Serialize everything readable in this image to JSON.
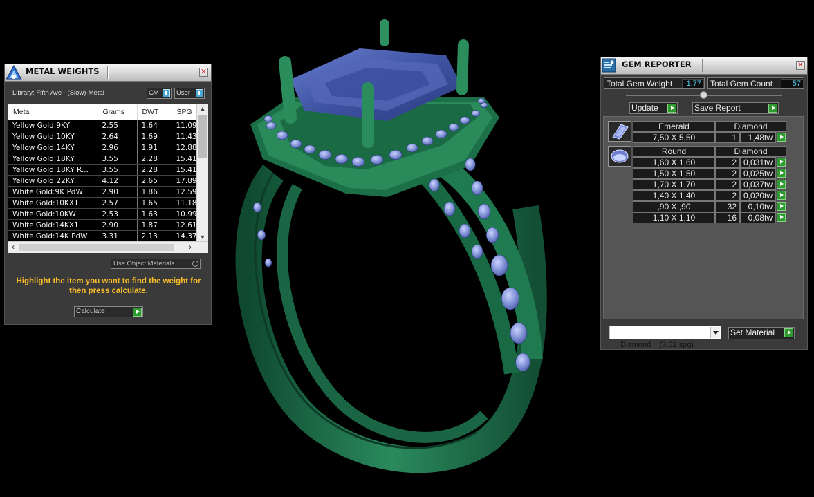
{
  "metal_weights": {
    "title": "METAL WEIGHTS",
    "library": "Library: Fifth Ave - (Slow)-Metal",
    "toggles": [
      "GV",
      "User"
    ],
    "columns": [
      "Metal",
      "Grams",
      "DWT",
      "SPG"
    ],
    "rows": [
      [
        "Yellow Gold:9KY",
        "2.55",
        "1.64",
        "11.09"
      ],
      [
        "Yellow Gold:10KY",
        "2.64",
        "1.69",
        "11.43"
      ],
      [
        "Yellow Gold:14KY",
        "2.96",
        "1.91",
        "12.88"
      ],
      [
        "Yellow Gold:18KY",
        "3.55",
        "2.28",
        "15.41"
      ],
      [
        "Yellow Gold:18KY R...",
        "3.55",
        "2.28",
        "15.41"
      ],
      [
        "Yellow Gold:22KY",
        "4.12",
        "2.65",
        "17.89"
      ],
      [
        "White Gold:9K PdW",
        "2.90",
        "1.86",
        "12.59"
      ],
      [
        "White Gold:10KX1",
        "2.57",
        "1.65",
        "11.18"
      ],
      [
        "White Gold:10KW",
        "2.53",
        "1.63",
        "10.99"
      ],
      [
        "White Gold:14KX1",
        "2.90",
        "1.87",
        "12.61"
      ],
      [
        "White Gold:14K PdW",
        "3.31",
        "2.13",
        "14.37"
      ]
    ],
    "use_object_materials": "Use Object Materials",
    "hint": "Highlight the item you want to find the weight for then press calculate.",
    "calculate_label": "Calculate"
  },
  "gem_reporter": {
    "title": "GEM REPORTER",
    "total_weight_label": "Total Gem Weight",
    "total_weight": "1,77",
    "total_count_label": "Total Gem Count",
    "total_count": "57",
    "update_label": "Update",
    "save_report_label": "Save Report",
    "groups": [
      {
        "shape": "Emerald",
        "material": "Diamond",
        "icon": "emerald-cut-gem-icon",
        "rows": [
          {
            "size": "7,50 X 5,50",
            "count": "1",
            "weight": "1,48tw"
          }
        ]
      },
      {
        "shape": "Round",
        "material": "Diamond",
        "icon": "round-gem-icon",
        "rows": [
          {
            "size": "1,60 X 1,60",
            "count": "2",
            "weight": "0,031tw"
          },
          {
            "size": "1,50 X 1,50",
            "count": "2",
            "weight": "0,025tw"
          },
          {
            "size": "1,70 X 1,70",
            "count": "2",
            "weight": "0,037tw"
          },
          {
            "size": "1,40 X 1,40",
            "count": "2",
            "weight": "0,020tw"
          },
          {
            "size": ",90 X ,90",
            "count": "32",
            "weight": "0,10tw"
          },
          {
            "size": "1,10 X 1,10",
            "count": "16",
            "weight": "0,08tw"
          }
        ]
      }
    ],
    "material_select": "Diamond    (3,52 spg)",
    "set_material_label": "Set Material"
  },
  "colors": {
    "metal": "#1e6b47",
    "gem": "#7f90d8",
    "center_stone": "#4457a8",
    "hint_text": "#f6bc2a",
    "value_text": "#58d0f0"
  }
}
